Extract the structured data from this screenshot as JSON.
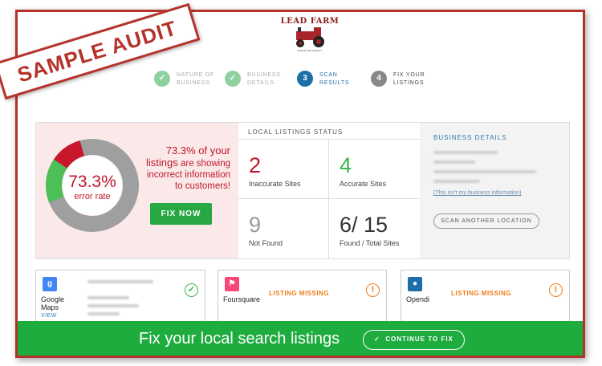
{
  "ribbon": {
    "label": "SAMPLE AUDIT"
  },
  "brand": {
    "logo_text": "LEAD FARM",
    "logo_subtext": "MARKETING AGENCY",
    "color": "#8b1d1d"
  },
  "stepper": {
    "steps": [
      {
        "label": "Nature of Business",
        "number": "1",
        "state": "done",
        "icon": "check-icon"
      },
      {
        "label": "Business Details",
        "number": "2",
        "state": "done",
        "icon": "check-icon"
      },
      {
        "label": "Scan Results",
        "number": "3",
        "state": "active"
      },
      {
        "label": "Fix your Listings",
        "number": "4",
        "state": "pending"
      }
    ]
  },
  "error_panel": {
    "error_rate_value": "73.3%",
    "error_rate_label": "error rate",
    "error_fraction": 0.733,
    "message_pct": "73.3% of your listings",
    "message_rest": "are showing incorrect information to customers!",
    "fix_button": "FIX NOW"
  },
  "status": {
    "title": "LOCAL LISTINGS STATUS",
    "inaccurate_count": "2",
    "inaccurate_label": "Inaccurate Sites",
    "accurate_count": "4",
    "accurate_label": "Accurate Sites",
    "not_found_count": "9",
    "not_found_label": "Not Found",
    "found_total": "6/ 15",
    "found_total_label": "Found / Total Sites"
  },
  "business": {
    "title": "BUSINESS DETAILS",
    "not_mine_link": "(This isn't my business information)",
    "scan_button": "SCAN ANOTHER LOCATION"
  },
  "listings": [
    {
      "name": "Google Maps",
      "view_label": "VIEW",
      "status": "ok",
      "icon": "google-icon",
      "color": "#4285f4"
    },
    {
      "name": "Foursquare",
      "status_text": "LISTING MISSING",
      "status": "warn",
      "icon": "foursquare-icon",
      "color": "#f94877"
    },
    {
      "name": "Opendi",
      "status_text": "LISTING MISSING",
      "status": "warn",
      "icon": "opendi-icon",
      "color": "#1d6fa9"
    }
  ],
  "bottom_bar": {
    "text": "Fix your local search listings",
    "button": "CONTINUE TO FIX"
  },
  "colors": {
    "green": "#1eac3e",
    "red": "#c0182b",
    "blue": "#1d6fa9",
    "orange": "#f07d1a",
    "frame": "#b5322a"
  }
}
